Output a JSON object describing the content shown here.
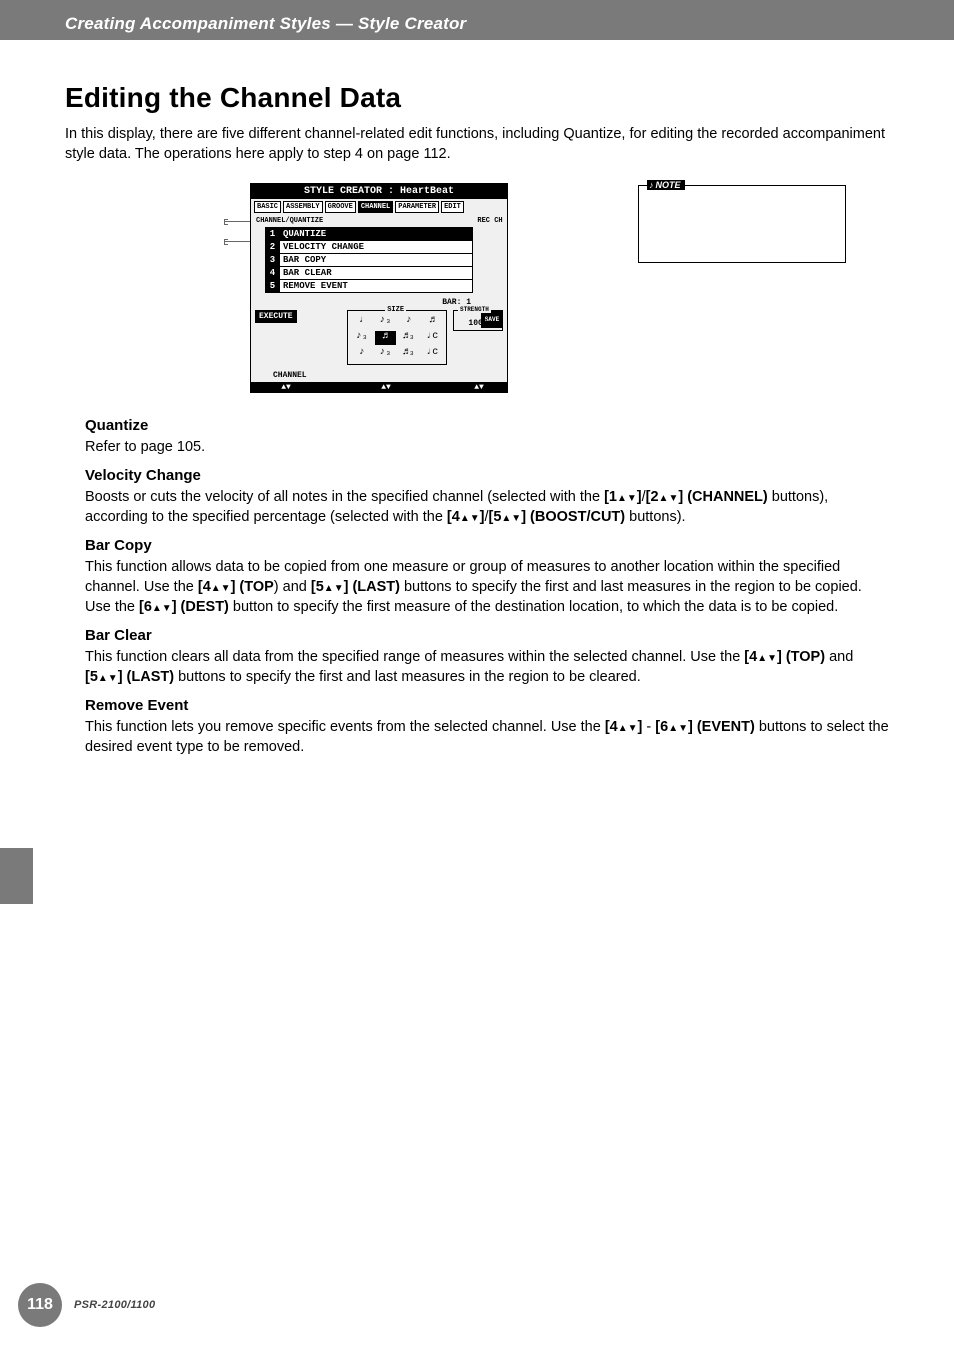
{
  "header": {
    "section_title": "Creating Accompaniment Styles — Style Creator"
  },
  "page": {
    "h1": "Editing the Channel Data",
    "intro": "In this display, there are five different channel-related edit functions, including Quantize, for editing the recorded accompaniment style data. The operations here apply to step 4 on page 112.",
    "page_number": "118",
    "model": "PSR-2100/1100"
  },
  "lcd": {
    "title": "STYLE CREATOR : HeartBeat",
    "tabs": [
      "BASIC",
      "ASSEMBLY",
      "GROOVE",
      "CHANNEL",
      "PARAMETER",
      "EDIT"
    ],
    "active_tab_index": 3,
    "subheader": "CHANNEL/QUANTIZE",
    "list": [
      {
        "n": "1",
        "label": "QUANTIZE",
        "selected": true
      },
      {
        "n": "2",
        "label": "VELOCITY CHANGE"
      },
      {
        "n": "3",
        "label": "BAR COPY"
      },
      {
        "n": "4",
        "label": "BAR CLEAR"
      },
      {
        "n": "5",
        "label": "REMOVE EVENT"
      }
    ],
    "regch": "REC CH",
    "bar_label": "BAR:    1",
    "execute": "EXECUTE",
    "size_label": "SIZE",
    "size_cells": [
      "♩",
      "♪₃",
      "♪",
      "♬",
      "♪₃",
      "♬",
      "♬₃",
      "♩c",
      "♪",
      "♪₃",
      "♬₃",
      "♩c"
    ],
    "size_selected_index": 5,
    "strength_label": "STRENGTH",
    "strength_value": "100%",
    "save_label": "SAVE",
    "channel_label": "CHANNEL",
    "arrows": "▲▼"
  },
  "note": {
    "tag": "NOTE"
  },
  "sections": {
    "quantize": {
      "h": "Quantize",
      "body_parts": [
        "Refer to page 105."
      ]
    },
    "velocity": {
      "h": "Velocity Change",
      "p1_a": "Boosts or cuts the velocity of all notes in the specified channel (selected with the ",
      "b1": "[1",
      "tri": "▲▼",
      "b1b": "]",
      "p1_sep1": "/",
      "b2": "[2",
      "b2b": "] (CHANNEL)",
      "p1_c": " buttons), according to the specified percentage (selected with the ",
      "b3": "[4",
      "b3b": "]",
      "p1_sep2": "/",
      "b4": "[5",
      "b4b": "] (BOOST/CUT)",
      "p1_d": " buttons)."
    },
    "barcopy": {
      "h": "Bar Copy",
      "p_a": "This function allows data to be copied from one measure or group of measures to another location within the specified channel. Use the ",
      "b1": "[4",
      "b1b": "] (TOP",
      "p_b": ") and ",
      "b2": "[5",
      "b2b": "] (LAST)",
      "p_c": " buttons to specify the first and last measures in the region to be copied. Use the ",
      "b3": "[6",
      "b3b": "] (DEST)",
      "p_d": " button to specify the first measure of the destination location, to which the data is to be copied."
    },
    "barclear": {
      "h": "Bar Clear",
      "p_a": "This function clears all data from the specified range of measures within the selected channel. Use the ",
      "b1": "[4",
      "b1b": "] (TOP)",
      "p_b": " and ",
      "b2": "[5",
      "b2b": "] (LAST)",
      "p_c": " buttons to specify the first and last measures in the region to be cleared."
    },
    "remove": {
      "h": "Remove Event",
      "p_a": "This function lets you remove specific events from the selected channel. Use the ",
      "b1": "[4",
      "b1b": "]",
      "p_b": " - ",
      "b2": "[6",
      "b2b": "] (EVENT)",
      "p_c": " buttons to select the desired event type to be removed."
    }
  }
}
